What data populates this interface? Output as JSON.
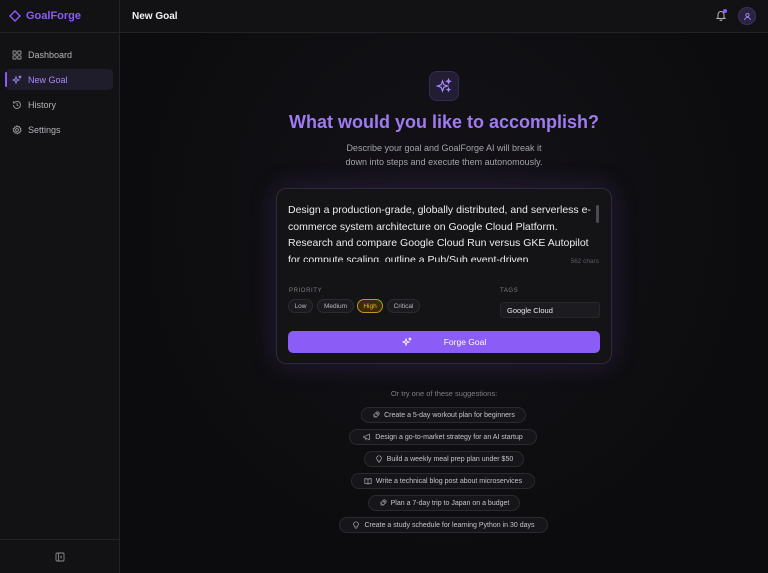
{
  "app": {
    "name": "GoalForge"
  },
  "sidebar": {
    "items": [
      {
        "label": "Dashboard",
        "icon": "dashboard-icon",
        "active": false
      },
      {
        "label": "New Goal",
        "icon": "sparkles-icon",
        "active": true
      },
      {
        "label": "History",
        "icon": "history-icon",
        "active": false
      },
      {
        "label": "Settings",
        "icon": "gear-icon",
        "active": false
      }
    ],
    "collapse_icon": "sidebar-collapse-icon"
  },
  "header": {
    "title": "New Goal"
  },
  "hero": {
    "heading": "What would you like to accomplish?",
    "subtitle_line1": "Describe your goal and GoalForge AI will break it",
    "subtitle_line2": "down into steps and execute them autonomously."
  },
  "form": {
    "goal_text": "Design a production-grade, globally distributed, and serverless e-commerce system architecture on Google Cloud Platform. Research and compare Google Cloud Run versus GKE Autopilot for compute scaling, outline a Pub/Sub event-driven",
    "char_count": "562 chars",
    "priority_label": "PRIORITY",
    "priority_options": [
      "Low",
      "Medium",
      "High",
      "Critical"
    ],
    "priority_selected": "High",
    "tags_label": "TAGS",
    "tags_value": "Google Cloud",
    "submit_label": "Forge Goal"
  },
  "suggestions": {
    "title": "Or try one of these suggestions:",
    "items": [
      {
        "icon": "rocket-icon",
        "label": "Create a 5-day workout plan for beginners"
      },
      {
        "icon": "megaphone-icon",
        "label": "Design a go-to-market strategy for an AI startup"
      },
      {
        "icon": "lightbulb-icon",
        "label": "Build a weekly meal prep plan under $50"
      },
      {
        "icon": "book-icon",
        "label": "Write a technical blog post about microservices"
      },
      {
        "icon": "rocket-icon",
        "label": "Plan a 7-day trip to Japan on a budget"
      },
      {
        "icon": "lightbulb-icon",
        "label": "Create a study schedule for learning Python in 30 days"
      }
    ]
  },
  "colors": {
    "accent": "#8b5cf6",
    "priority_active": "#f0b43c",
    "background": "#0b0b0d"
  }
}
